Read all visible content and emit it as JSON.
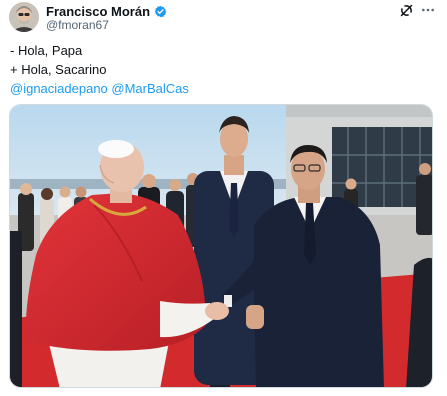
{
  "author": {
    "display_name": "Francisco Morán",
    "handle": "@fmoran67",
    "avatar_icon": "avatar-photo",
    "verified_icon": "verified-badge-icon"
  },
  "actions": {
    "grok_icon": "grok-icon",
    "more_icon": "more-options-icon"
  },
  "text": {
    "line1": "- Hola, Papa",
    "line2": "+ Hola, Sacarino",
    "mention1": "@ignaciadepano",
    "mention2": "@MarBalCas"
  },
  "media": {
    "type": "photo"
  },
  "colors": {
    "link": "#1d9bf0",
    "verified": "#1d9bf0",
    "secondary_text": "#536471"
  }
}
